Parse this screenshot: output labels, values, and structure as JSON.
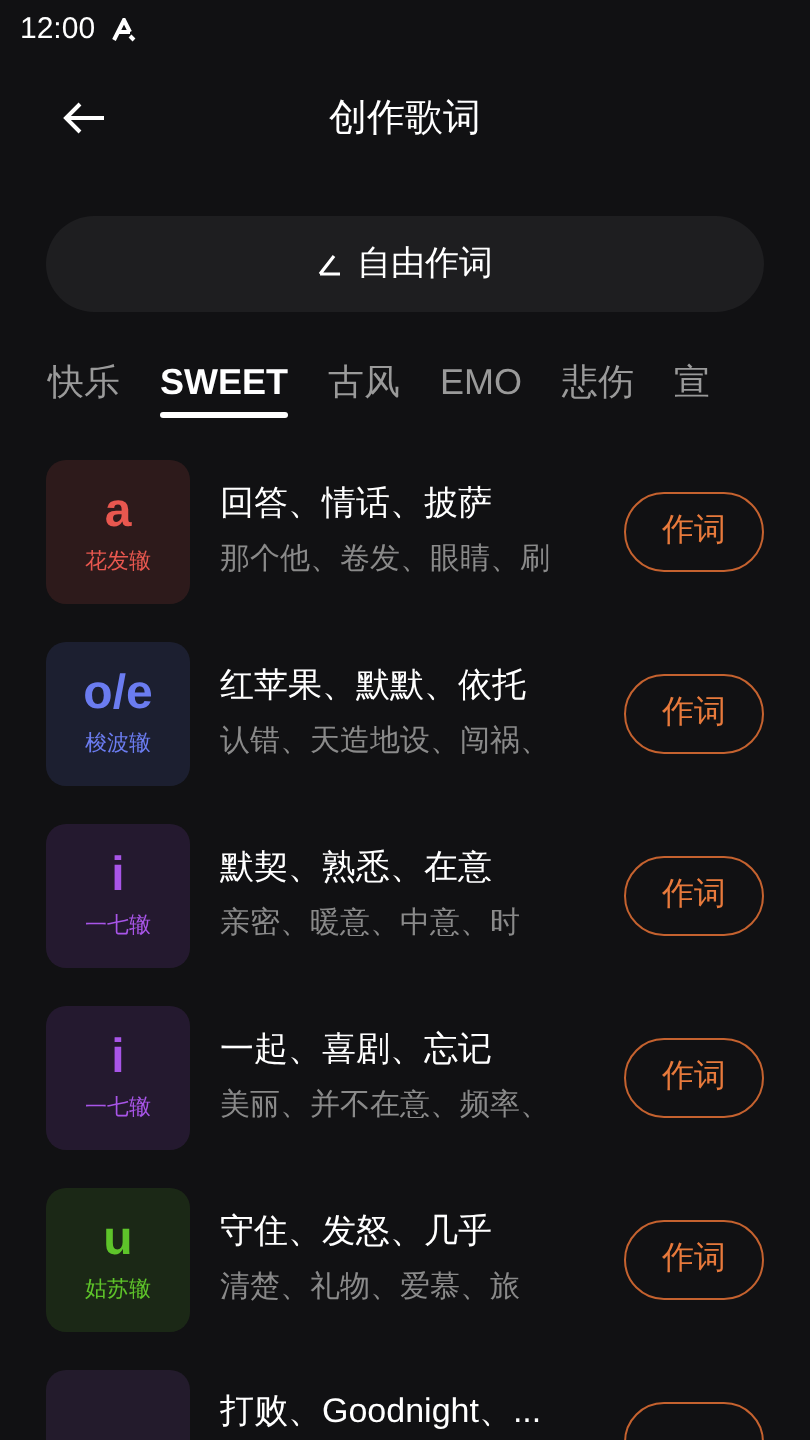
{
  "status_bar": {
    "time": "12:00"
  },
  "header": {
    "title": "创作歌词"
  },
  "free_button": {
    "label": "自由作词"
  },
  "tabs": [
    {
      "label": "快乐",
      "selected": false
    },
    {
      "label": "SWEET",
      "selected": true
    },
    {
      "label": "古风",
      "selected": false
    },
    {
      "label": "EMO",
      "selected": false
    },
    {
      "label": "悲伤",
      "selected": false
    },
    {
      "label": "宣",
      "selected": false
    }
  ],
  "rhymes": [
    {
      "letter": "a",
      "name": "花发辙",
      "color": "#e8574f",
      "title": "回答、情话、披萨",
      "examples": "那个他、卷发、眼睛、刷",
      "action": "作词"
    },
    {
      "letter": "o/e",
      "name": "梭波辙",
      "color": "#6b7cf0",
      "title": "红苹果、默默、依托",
      "examples": "认错、天造地设、闯祸、",
      "action": "作词"
    },
    {
      "letter": "i",
      "name": "一七辙",
      "color": "#a855e8",
      "title": "默契、熟悉、在意",
      "examples": "亲密、暖意、中意、时",
      "action": "作词"
    },
    {
      "letter": "i",
      "name": "一七辙",
      "color": "#a855e8",
      "title": "一起、喜剧、忘记",
      "examples": "美丽、并不在意、频率、",
      "action": "作词"
    },
    {
      "letter": "u",
      "name": "姑苏辙",
      "color": "#5ec42a",
      "title": "守住、发怒、几乎",
      "examples": "清楚、礼物、爱慕、旅",
      "action": "作词"
    },
    {
      "title": "打败、Goodnight、..."
    }
  ]
}
